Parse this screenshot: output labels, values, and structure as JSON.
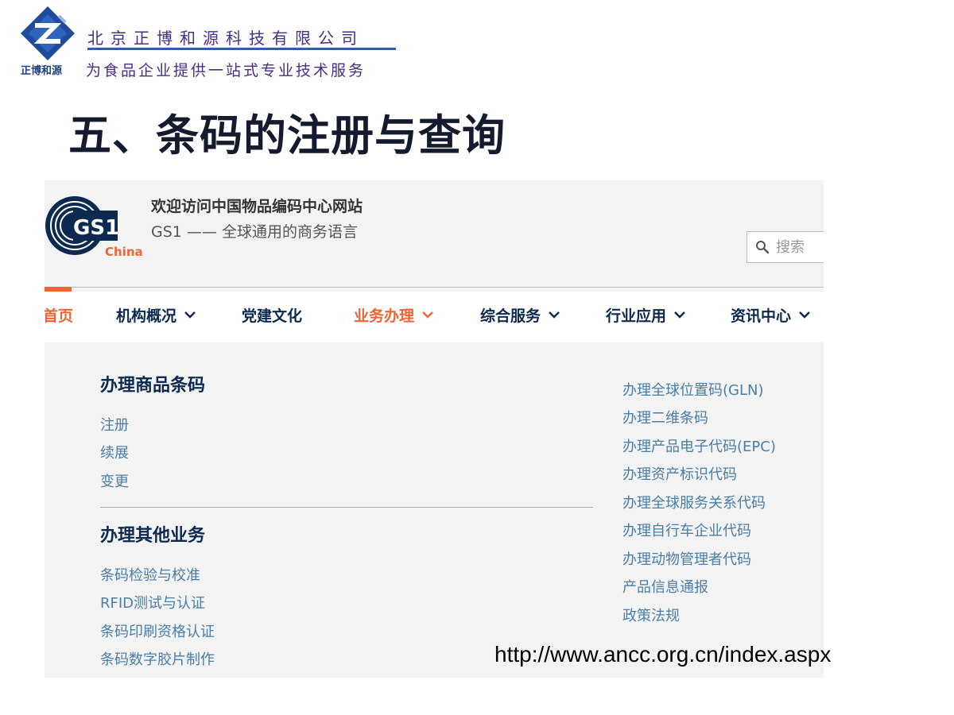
{
  "slide": {
    "logo_caption": "正博和源",
    "company_name": "北京正博和源科技有限公司",
    "tagline": "为食品企业提供一站式专业技术服务",
    "title": "五、条码的注册与查询",
    "url": "http://www.ancc.org.cn/index.aspx"
  },
  "site": {
    "logo_text": "GS1",
    "logo_sub": "China",
    "welcome": "欢迎访问中国物品编码中心网站",
    "slogan": "GS1 —— 全球通用的商务语言",
    "search": {
      "placeholder": "搜索",
      "icon": "search-icon"
    },
    "nav": [
      {
        "label": "首页"
      },
      {
        "label": "机构概况"
      },
      {
        "label": "党建文化"
      },
      {
        "label": "业务办理"
      },
      {
        "label": "综合服务"
      },
      {
        "label": "行业应用"
      },
      {
        "label": "资讯中心"
      }
    ],
    "dropdown": {
      "section1": {
        "heading": "办理商品条码",
        "links": [
          "注册",
          "续展",
          "变更"
        ]
      },
      "section2": {
        "heading": "办理其他业务",
        "links": [
          "条码检验与校准",
          "RFID测试与认证",
          "条码印刷资格认证",
          "条码数字胶片制作"
        ]
      },
      "right_links": [
        "办理全球位置码(GLN)",
        "办理二维条码",
        "办理产品电子代码(EPC)",
        "办理资产标识代码",
        "办理全球服务关系代码",
        "办理自行车企业代码",
        "办理动物管理者代码",
        "产品信息通报",
        "政策法规"
      ]
    }
  },
  "colors": {
    "accent": "#f26334",
    "navy": "#0c2a4f",
    "link": "#4a7ea7",
    "company": "#4a2d86"
  }
}
